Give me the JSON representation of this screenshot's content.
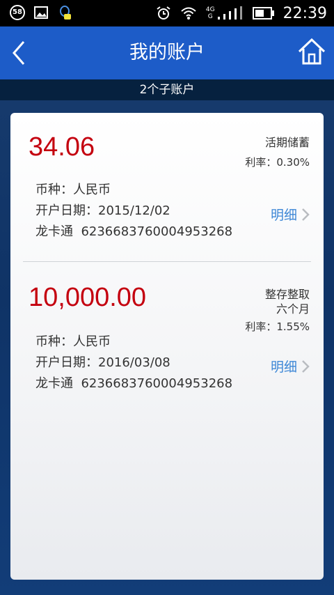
{
  "status": {
    "notification_count": "58",
    "network": {
      "top": "4G",
      "bottom": "G"
    },
    "time": "22:39",
    "icons": [
      "image-icon",
      "qq-icon",
      "alarm-icon",
      "wifi-icon",
      "signal-icon",
      "battery-icon"
    ]
  },
  "header": {
    "title": "我的账户",
    "subtitle": "2个子账户"
  },
  "accounts": [
    {
      "amount": "34.06",
      "type_line1": "活期储蓄",
      "type_line2": "",
      "rate": "利率：0.30%",
      "currency_label": "币种：",
      "currency": "人民币",
      "date_label": "开户日期：",
      "date": "2015/12/02",
      "card_label": "龙卡通  ",
      "card_number": "6236683760004953268",
      "detail": "明细"
    },
    {
      "amount": "10,000.00",
      "type_line1": "整存整取",
      "type_line2": "六个月",
      "rate": "利率：1.55%",
      "currency_label": "币种：",
      "currency": "人民币",
      "date_label": "开户日期：",
      "date": "2016/03/08",
      "card_label": "龙卡通  ",
      "card_number": "6236683760004953268",
      "detail": "明细"
    }
  ],
  "colors": {
    "header_blue": "#1d5cc8",
    "amount_red": "#c4000f",
    "link_blue": "#3d87d6"
  }
}
